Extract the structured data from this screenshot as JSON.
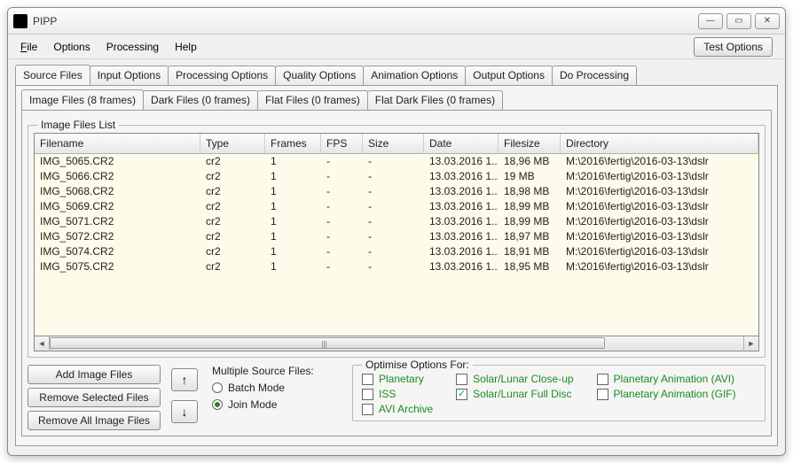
{
  "window": {
    "title": "PIPP"
  },
  "menu": {
    "file": "File",
    "options": "Options",
    "processing": "Processing",
    "help": "Help",
    "test": "Test Options"
  },
  "tabs": [
    "Source Files",
    "Input Options",
    "Processing Options",
    "Quality Options",
    "Animation Options",
    "Output Options",
    "Do Processing"
  ],
  "subtabs": [
    "Image Files (8 frames)",
    "Dark Files (0 frames)",
    "Flat Files (0 frames)",
    "Flat Dark Files (0 frames)"
  ],
  "list_group_title": "Image Files List",
  "columns": [
    "Filename",
    "Type",
    "Frames",
    "FPS",
    "Size",
    "Date",
    "Filesize",
    "Directory"
  ],
  "rows": [
    {
      "filename": "IMG_5065.CR2",
      "type": "cr2",
      "frames": "1",
      "fps": "-",
      "size": "-",
      "date": "13.03.2016 1...",
      "filesize": "18,96 MB",
      "dir": "M:\\2016\\fertig\\2016-03-13\\dslr"
    },
    {
      "filename": "IMG_5066.CR2",
      "type": "cr2",
      "frames": "1",
      "fps": "-",
      "size": "-",
      "date": "13.03.2016 1...",
      "filesize": "19 MB",
      "dir": "M:\\2016\\fertig\\2016-03-13\\dslr"
    },
    {
      "filename": "IMG_5068.CR2",
      "type": "cr2",
      "frames": "1",
      "fps": "-",
      "size": "-",
      "date": "13.03.2016 1...",
      "filesize": "18,98 MB",
      "dir": "M:\\2016\\fertig\\2016-03-13\\dslr"
    },
    {
      "filename": "IMG_5069.CR2",
      "type": "cr2",
      "frames": "1",
      "fps": "-",
      "size": "-",
      "date": "13.03.2016 1...",
      "filesize": "18,99 MB",
      "dir": "M:\\2016\\fertig\\2016-03-13\\dslr"
    },
    {
      "filename": "IMG_5071.CR2",
      "type": "cr2",
      "frames": "1",
      "fps": "-",
      "size": "-",
      "date": "13.03.2016 1...",
      "filesize": "18,99 MB",
      "dir": "M:\\2016\\fertig\\2016-03-13\\dslr"
    },
    {
      "filename": "IMG_5072.CR2",
      "type": "cr2",
      "frames": "1",
      "fps": "-",
      "size": "-",
      "date": "13.03.2016 1...",
      "filesize": "18,97 MB",
      "dir": "M:\\2016\\fertig\\2016-03-13\\dslr"
    },
    {
      "filename": "IMG_5074.CR2",
      "type": "cr2",
      "frames": "1",
      "fps": "-",
      "size": "-",
      "date": "13.03.2016 1...",
      "filesize": "18,91 MB",
      "dir": "M:\\2016\\fertig\\2016-03-13\\dslr"
    },
    {
      "filename": "IMG_5075.CR2",
      "type": "cr2",
      "frames": "1",
      "fps": "-",
      "size": "-",
      "date": "13.03.2016 1...",
      "filesize": "18,95 MB",
      "dir": "M:\\2016\\fertig\\2016-03-13\\dslr"
    }
  ],
  "buttons": {
    "add": "Add Image Files",
    "remove_sel": "Remove Selected Files",
    "remove_all": "Remove All Image Files"
  },
  "multi_src": {
    "title": "Multiple Source Files:",
    "batch": "Batch Mode",
    "join": "Join Mode",
    "selected": "join"
  },
  "optimise": {
    "title": "Optimise Options For:",
    "col1": [
      "Planetary",
      "ISS",
      "AVI Archive"
    ],
    "col2": [
      "Solar/Lunar Close-up",
      "Solar/Lunar Full Disc"
    ],
    "col3": [
      "Planetary Animation (AVI)",
      "Planetary Animation (GIF)"
    ],
    "checked": "Solar/Lunar Full Disc"
  }
}
